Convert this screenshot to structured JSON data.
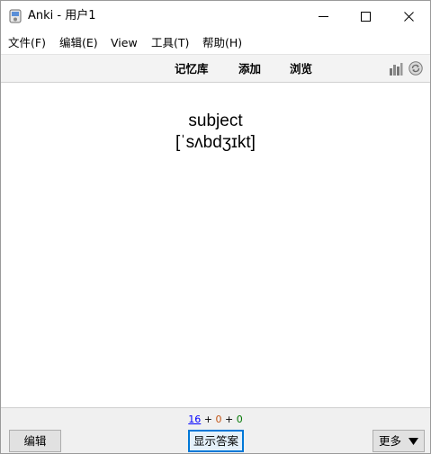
{
  "window": {
    "title": "Anki - 用户1"
  },
  "menu": {
    "file": "文件(F)",
    "edit": "编辑(E)",
    "view": "View",
    "tools": "工具(T)",
    "help": "帮助(H)"
  },
  "toolbar": {
    "decks": "记忆库",
    "add": "添加",
    "browse": "浏览"
  },
  "card": {
    "word": "subject",
    "phonetic": "[ˈsʌbdʒɪkt]"
  },
  "counts": {
    "new": "16",
    "learn": "0",
    "review": "0",
    "sep": "+"
  },
  "bottom": {
    "edit_label": "编辑",
    "show_answer_label": "显示答案",
    "more_label": "更多"
  },
  "colors": {
    "new": "#0000ff",
    "learn": "#c35617",
    "review": "#007700",
    "focus": "#0078d7"
  }
}
